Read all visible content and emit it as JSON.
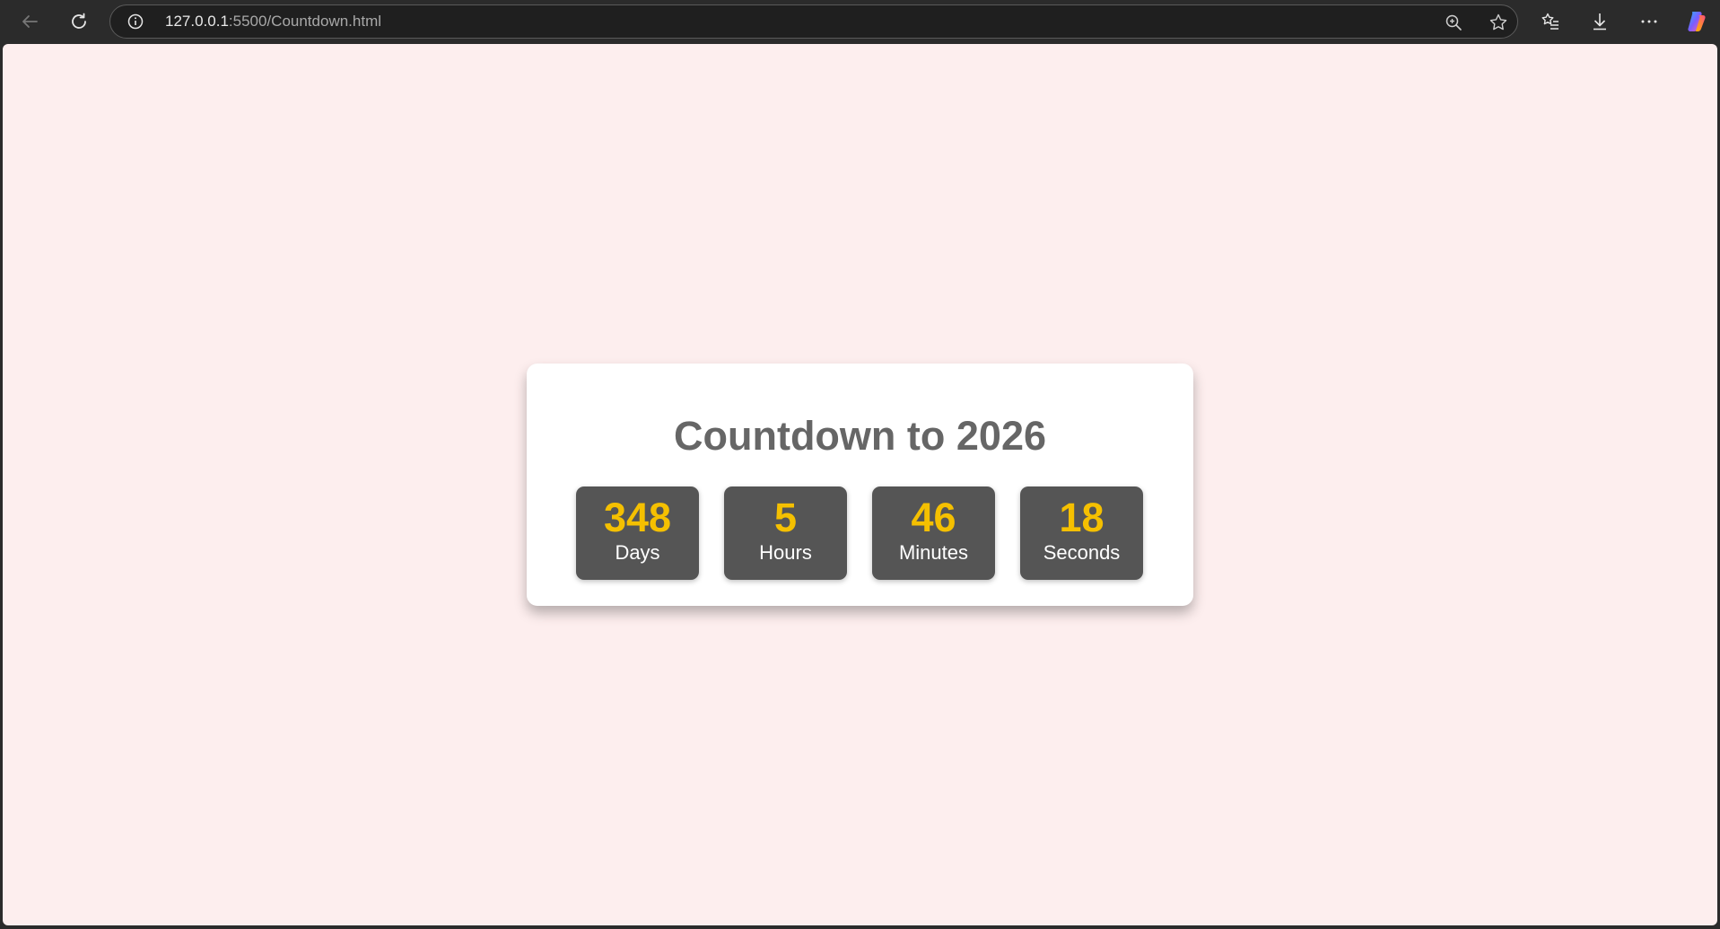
{
  "browser": {
    "url_host": "127.0.0.1",
    "url_path": ":5500/Countdown.html",
    "icons": {
      "back": "back-arrow-icon",
      "refresh": "refresh-icon",
      "info": "info-icon",
      "zoom": "zoom-in-icon",
      "favorite": "star-icon",
      "favorites_list": "favorites-icon",
      "downloads": "download-icon",
      "menu": "more-icon",
      "copilot": "copilot-icon"
    }
  },
  "page": {
    "background": "#fdeeee",
    "title": "Countdown to 2026",
    "timer": [
      {
        "value": "348",
        "label": "Days"
      },
      {
        "value": "5",
        "label": "Hours"
      },
      {
        "value": "46",
        "label": "Minutes"
      },
      {
        "value": "18",
        "label": "Seconds"
      }
    ],
    "colors": {
      "title": "#666666",
      "box": "#555555",
      "number": "#f5c000",
      "label": "#ffffff"
    }
  }
}
